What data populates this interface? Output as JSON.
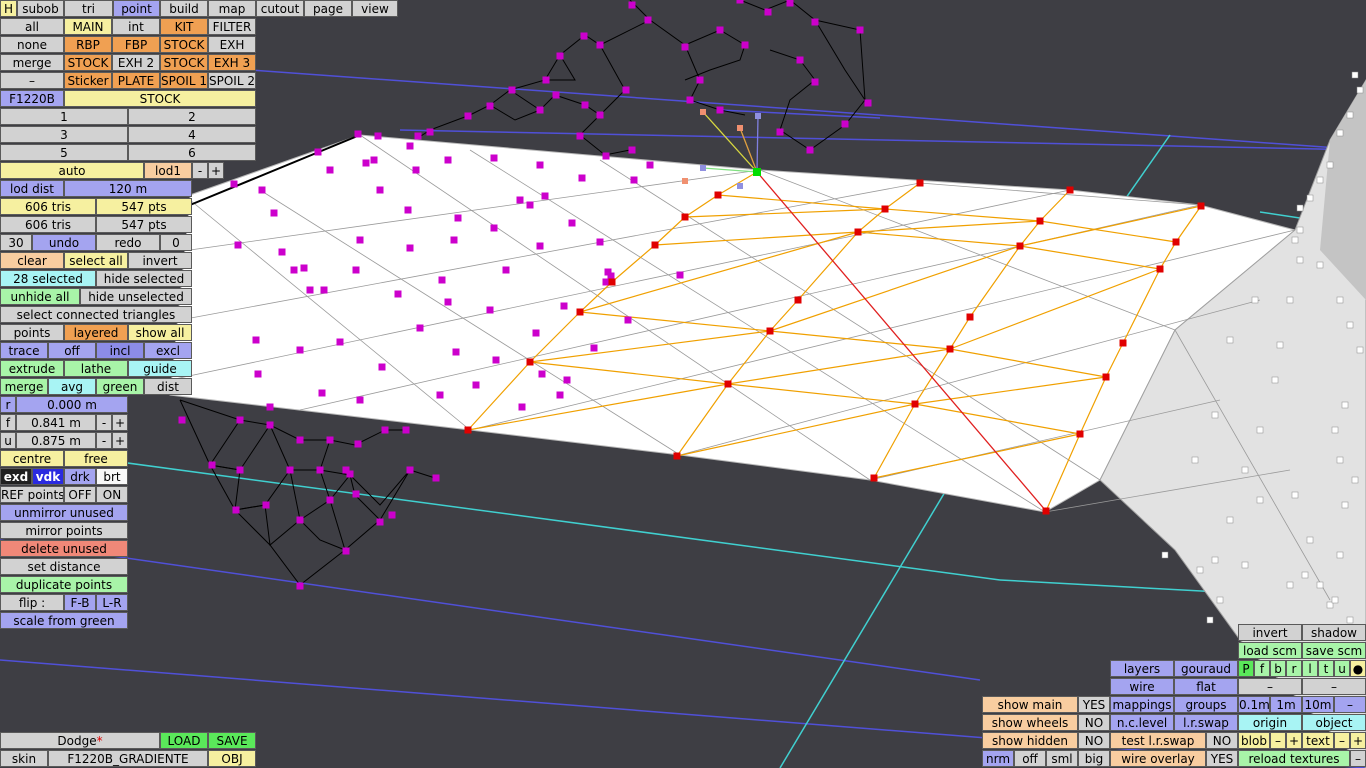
{
  "menu": [
    "H",
    "subob",
    "tri",
    "point",
    "build",
    "map",
    "cutout",
    "page",
    "view"
  ],
  "parts": {
    "row1": [
      "all",
      "MAIN",
      "int",
      "KIT",
      "FILTER"
    ],
    "row2": [
      "none",
      "RBP",
      "FBP",
      "STOCK",
      "EXH"
    ],
    "row3": [
      "merge",
      "STOCK",
      "EXH 2",
      "STOCK",
      "EXH 3"
    ],
    "row4": [
      "–",
      "Sticker",
      "PLATE",
      "SPOIL 1",
      "SPOIL 2"
    ]
  },
  "car_code": "F1220B",
  "variant": "STOCK",
  "nums": [
    "1",
    "2",
    "3",
    "4",
    "5",
    "6"
  ],
  "lod": {
    "auto": "auto",
    "lod1": "lod1",
    "minus": "-",
    "plus": "+",
    "dist_label": "lod dist",
    "dist_value": "120 m"
  },
  "stats": {
    "tris1": "606 tris",
    "pts1": "547 pts",
    "tris2": "606 tris",
    "pts2": "547 pts"
  },
  "undo": {
    "count": "30",
    "undo": "undo",
    "redo": "redo",
    "redo_count": "0"
  },
  "selection": {
    "clear": "clear",
    "select_all": "select all",
    "invert": "invert",
    "selected": "28 selected",
    "hide_selected": "hide selected",
    "unhide_all": "unhide all",
    "hide_unselected": "hide unselected",
    "connected": "select connected triangles"
  },
  "points_row": {
    "points": "points",
    "layered": "layered",
    "show_all": "show all"
  },
  "trace_row": {
    "trace": "trace",
    "off": "off",
    "incl": "incl",
    "excl": "excl"
  },
  "extrude_row": {
    "extrude": "extrude",
    "lathe": "lathe",
    "guide": "guide"
  },
  "merge_row": {
    "merge": "merge",
    "avg": "avg",
    "green": "green",
    "dist": "dist"
  },
  "rfu": {
    "r_label": "r",
    "r_value": "0.000 m",
    "f_label": "f",
    "f_value": "0.841 m",
    "u_label": "u",
    "u_value": "0.875 m",
    "minus": "-",
    "plus": "+"
  },
  "centre_row": {
    "centre": "centre",
    "free": "free"
  },
  "render_row": {
    "exd": "exd",
    "vdk": "vdk",
    "drk": "drk",
    "brt": "brt"
  },
  "ref_row": {
    "ref": "REF points",
    "off": "OFF",
    "on": "ON"
  },
  "tools": {
    "unmirror": "unmirror unused",
    "mirror": "mirror points",
    "delete": "delete unused",
    "set_distance": "set distance",
    "duplicate": "duplicate points",
    "flip": "flip :",
    "fb": "F-B",
    "lr": "L-R",
    "scale": "scale from green"
  },
  "bottom_left": {
    "car_name": "Dodge",
    "load": "LOAD",
    "save": "SAVE",
    "skin_label": "skin",
    "skin_value": "F1220B_GRADIENTE",
    "obj": "OBJ"
  },
  "right_panel": {
    "invert": "invert",
    "shadow": "shadow",
    "load_scm": "load scm",
    "save_scm": "save scm",
    "letters": [
      "P",
      "f",
      "b",
      "r",
      "l",
      "t",
      "u",
      "●"
    ],
    "dash1": "–",
    "dash2": "–",
    "layers": "layers",
    "gouraud": "gouraud",
    "wire": "wire",
    "flat": "flat",
    "mappings": "mappings",
    "groups": "groups",
    "m01": "0.1m",
    "m1": "1m",
    "m10": "10m",
    "mminus": "–",
    "show_main": "show main",
    "yes1": "YES",
    "show_wheels": "show wheels",
    "no1": "NO",
    "nc_level": "n.c.level",
    "lr_swap": "l.r.swap",
    "origin": "origin",
    "object": "object",
    "show_hidden": "show hidden",
    "no2": "NO",
    "test_lr": "test l.r.swap",
    "no3": "NO",
    "blob": "blob",
    "minus": "–",
    "plus": "+",
    "text": "text",
    "nrm": "nrm",
    "off": "off",
    "sml": "sml",
    "big": "big",
    "wire_overlay": "wire overlay",
    "yes2": "YES",
    "reload": "reload textures"
  },
  "colors": {
    "viewport_bg": "#3e3e44",
    "surface": "#ffffff",
    "selected_point": "#e00000",
    "magenta_point": "#cc00cc",
    "active_point": "#00dd00"
  }
}
